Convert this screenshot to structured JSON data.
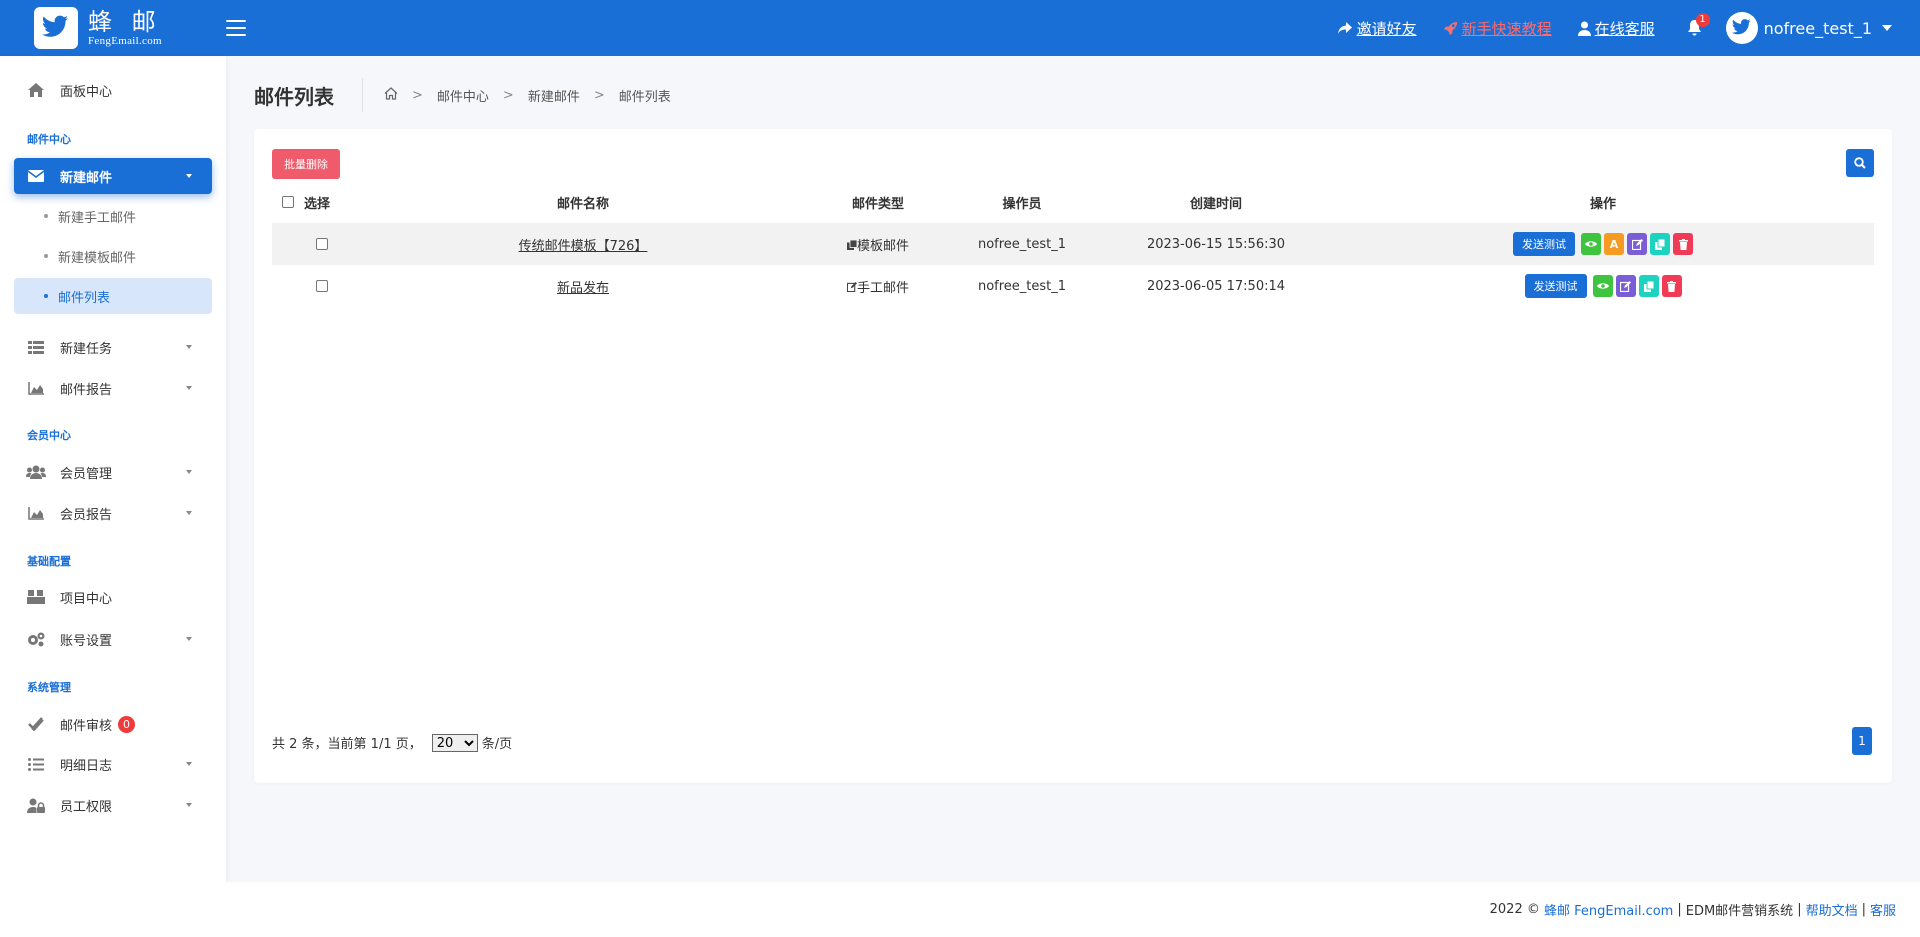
{
  "brand": {
    "name_cn": "蜂 邮",
    "name_en": "FengEmail.com"
  },
  "header": {
    "invite": "邀请好友",
    "tutorial": "新手快速教程",
    "support": "在线客服",
    "notification_count": "1",
    "username": "nofree_test_1"
  },
  "sidebar": {
    "dashboard": "面板中心",
    "section_mail": "邮件中心",
    "new_mail": "新建邮件",
    "new_manual": "新建手工邮件",
    "new_template": "新建模板邮件",
    "mail_list": "邮件列表",
    "new_task": "新建任务",
    "mail_report": "邮件报告",
    "section_member": "会员中心",
    "member_manage": "会员管理",
    "member_report": "会员报告",
    "section_basic": "基础配置",
    "project_center": "项目中心",
    "account_settings": "账号设置",
    "section_system": "系统管理",
    "mail_review": "邮件审核",
    "mail_review_badge": "0",
    "detail_log": "明细日志",
    "staff_permission": "员工权限"
  },
  "page": {
    "title": "邮件列表",
    "breadcrumb": [
      "邮件中心",
      "新建邮件",
      "邮件列表"
    ]
  },
  "toolbar": {
    "batch_delete": "批量删除"
  },
  "table": {
    "headers": {
      "select": "选择",
      "name": "邮件名称",
      "type": "邮件类型",
      "operator": "操作员",
      "created": "创建时间",
      "actions": "操作"
    },
    "rows": [
      {
        "name": "传统邮件模板【726】",
        "type": "模板邮件",
        "operator": "nofree_test_1",
        "created": "2023-06-15 15:56:30",
        "test_label": "发送测试"
      },
      {
        "name": "新品发布",
        "type": "手工邮件",
        "operator": "nofree_test_1",
        "created": "2023-06-05 17:50:14",
        "test_label": "发送测试"
      }
    ],
    "op_letter": "A"
  },
  "pagination": {
    "summary": "共 2 条，当前第 1/1 页，",
    "page_size": "20",
    "unit": "条/页",
    "current_page": "1"
  },
  "footer": {
    "year": "2022 ©",
    "brand_link": "蜂邮 FengEmail.com",
    "system": "EDM邮件营销系统",
    "help": "帮助文档",
    "service": "客服"
  },
  "colors": {
    "primary": "#1a6fd6",
    "danger": "#ef5b6b",
    "success": "#3ec43e",
    "warning": "#f59a23",
    "purple": "#7b5ed6",
    "teal": "#1dd3c0",
    "red": "#ef3b55"
  }
}
